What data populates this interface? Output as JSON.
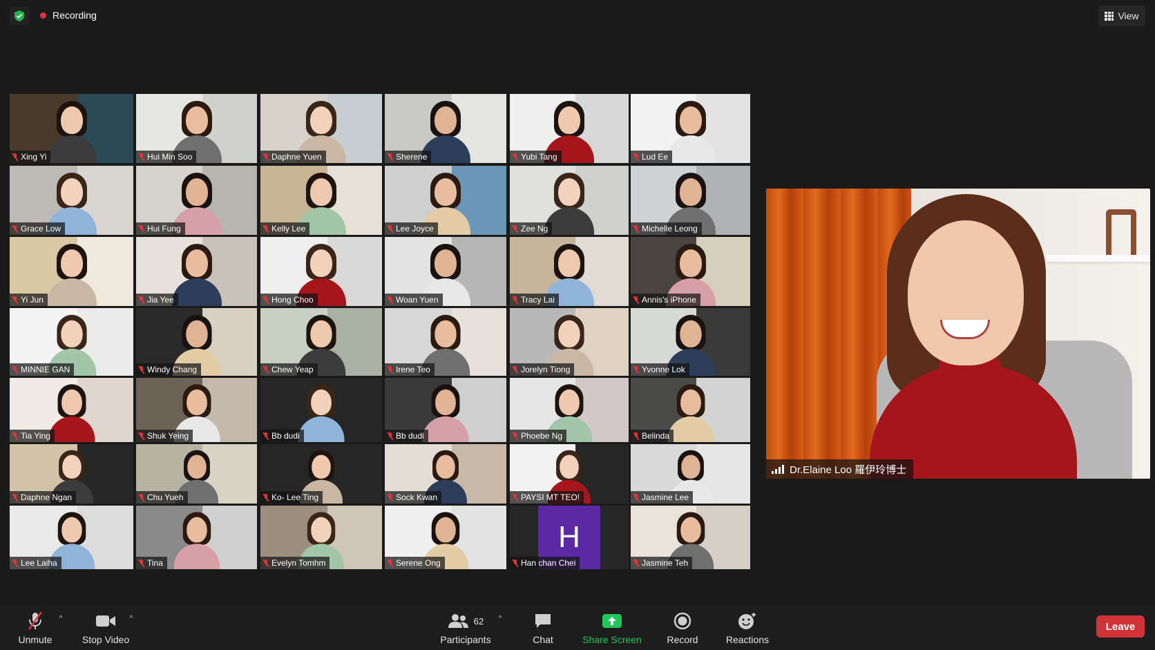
{
  "top_bar": {
    "recording_label": "Recording",
    "view_label": "View"
  },
  "participants": [
    {
      "name": "Xing Yi"
    },
    {
      "name": "Hui Min Soo"
    },
    {
      "name": "Daphne Yuen"
    },
    {
      "name": "Sherene"
    },
    {
      "name": "Yubi Tang"
    },
    {
      "name": "Lud Ee"
    },
    {
      "name": "Grace Low"
    },
    {
      "name": "Hui Fung"
    },
    {
      "name": "Kelly Lee"
    },
    {
      "name": "Lee Joyce"
    },
    {
      "name": "Zee Ng"
    },
    {
      "name": "Michelle Leong"
    },
    {
      "name": "Yi Jun"
    },
    {
      "name": "Jia Yee"
    },
    {
      "name": "Hong Choo"
    },
    {
      "name": "Woan Yuen"
    },
    {
      "name": "Tracy Lai"
    },
    {
      "name": "Annis's iPhone"
    },
    {
      "name": "MINNIE GAN"
    },
    {
      "name": "Windy Chang"
    },
    {
      "name": "Chew Yeap"
    },
    {
      "name": "Irene Teo"
    },
    {
      "name": "Jorelyn Tiong"
    },
    {
      "name": "Yvonne Lok"
    },
    {
      "name": "Tia Ying"
    },
    {
      "name": "Shuk Yeing"
    },
    {
      "name": "Bb dudi"
    },
    {
      "name": "Bb dudi"
    },
    {
      "name": "Phoebe Ng"
    },
    {
      "name": "Belinda"
    },
    {
      "name": "Daphne Ngan"
    },
    {
      "name": "Chu Yueh"
    },
    {
      "name": "Ko- Lee Ting"
    },
    {
      "name": "Sock Kwan"
    },
    {
      "name": "PAYSI MT TEO!"
    },
    {
      "name": "Jasmine Lee"
    },
    {
      "name": "Lee Laiha"
    },
    {
      "name": "Tina"
    },
    {
      "name": "Evelyn Tomhm"
    },
    {
      "name": "Serene Ong"
    },
    {
      "name": "Han chan Chei",
      "avatar_letter": "H"
    },
    {
      "name": "Jasmine Teh"
    }
  ],
  "active_speaker": {
    "name": "Dr.Elaine Loo 羅伊玲博士"
  },
  "toolbar": {
    "unmute_label": "Unmute",
    "stop_video_label": "Stop Video",
    "participants_label": "Participants",
    "participants_count": "62",
    "chat_label": "Chat",
    "share_screen_label": "Share Screen",
    "record_label": "Record",
    "reactions_label": "Reactions",
    "leave_label": "Leave"
  },
  "colors": {
    "recording_dot": "#e0353a",
    "share_green": "#20c75a",
    "leave_red": "#d13438",
    "avatar_purple": "#5a29a3"
  }
}
